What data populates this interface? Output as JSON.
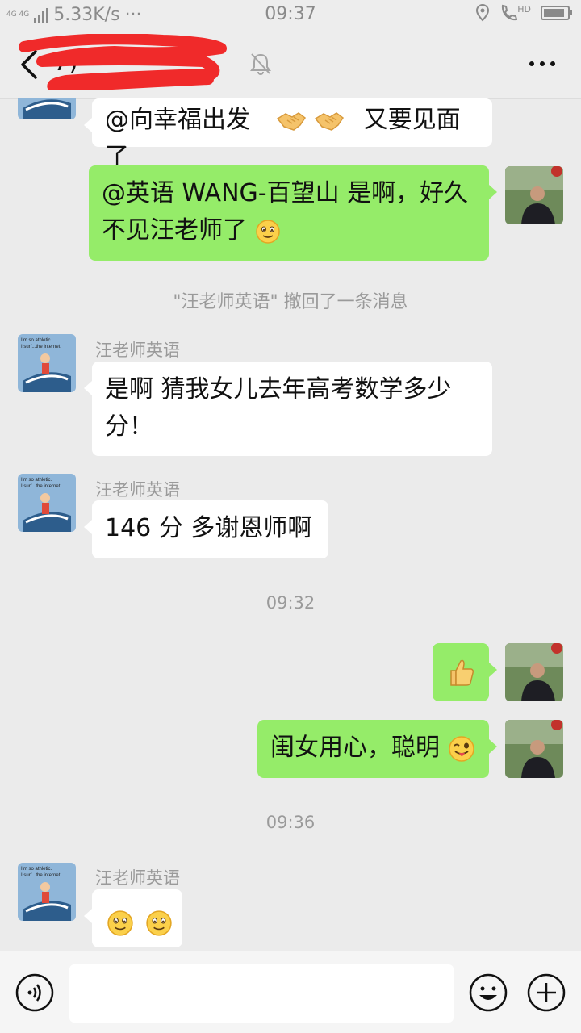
{
  "status_bar": {
    "network_type": "4G 4G",
    "speed": "5.33K/s",
    "dots": "···",
    "time": "09:37",
    "hd": "HD",
    "battery_level": 0.9
  },
  "header": {
    "title": "7)",
    "more_label": "more"
  },
  "messages": {
    "m1": {
      "text_a": "@向幸福出发",
      "text_b": "又要见面了",
      "emoji": "handshake-icon"
    },
    "m2": {
      "line1": "@英语 WANG-百望山  是啊，好久",
      "line2": "不见汪老师了"
    },
    "recall": "\"汪老师英语\" 撤回了一条消息",
    "m3": {
      "sender": "汪老师英语",
      "line1": "是啊  猜我女儿去年高考数学多少",
      "line2": "分！"
    },
    "m4": {
      "sender": "汪老师英语",
      "text": "146 分  多谢恩师啊"
    },
    "time1": "09:32",
    "m5": {
      "emoji": "thumbs-up-icon"
    },
    "m6": {
      "text": "闺女用心，聪明"
    },
    "time2": "09:36",
    "m7": {
      "sender": "汪老师英语"
    }
  },
  "avatar_text": {
    "line1": "I'm so athletic.",
    "line2": "I surf...the internet."
  },
  "input": {
    "placeholder": ""
  },
  "colors": {
    "outgoing_bubble": "#95ec69",
    "incoming_bubble": "#ffffff",
    "background": "#ebebeb"
  }
}
